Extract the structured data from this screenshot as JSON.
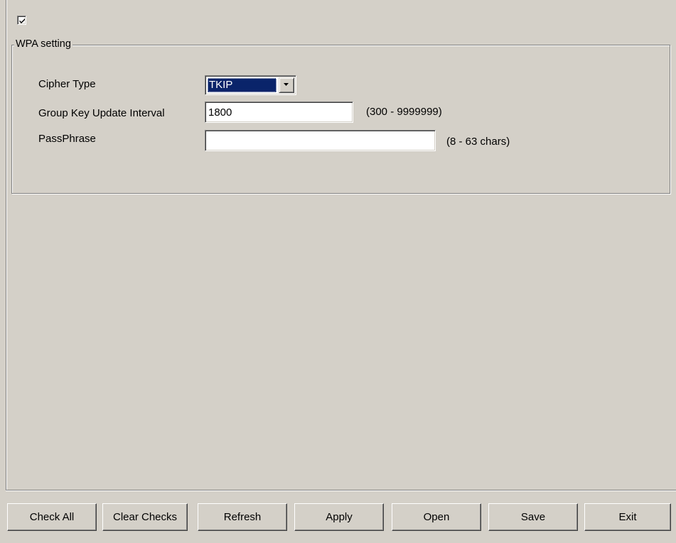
{
  "enable_checkbox": {
    "checked": true
  },
  "wpa": {
    "group_title": "WPA setting",
    "cipher_type_label": "Cipher Type",
    "cipher_type_value": "TKIP",
    "group_key_label": "Group Key Update Interval",
    "group_key_value": "1800",
    "group_key_hint": "(300 - 9999999)",
    "passphrase_label": "PassPhrase",
    "passphrase_value": "",
    "passphrase_hint": "(8 - 63 chars)"
  },
  "buttons": {
    "check_all": "Check All",
    "clear_checks": "Clear Checks",
    "refresh": "Refresh",
    "apply": "Apply",
    "open": "Open",
    "save": "Save",
    "exit": "Exit"
  },
  "colors": {
    "face": "#d4d0c8",
    "selection": "#0a246a"
  }
}
